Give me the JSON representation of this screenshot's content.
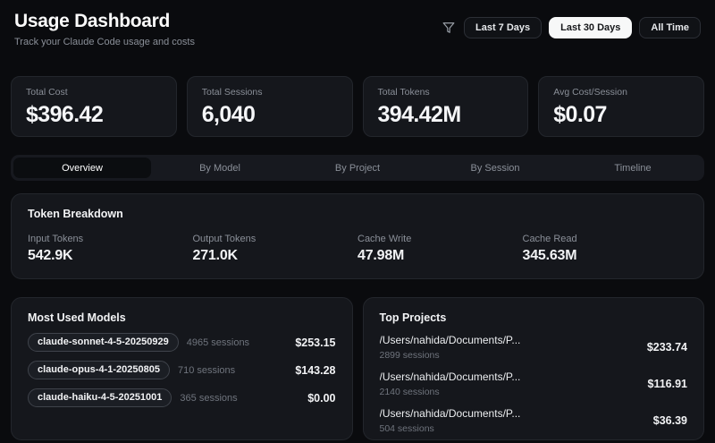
{
  "header": {
    "title": "Usage Dashboard",
    "subtitle": "Track your Claude Code usage and costs",
    "filter_icon": "funnel-icon",
    "ranges": [
      {
        "label": "Last 7 Days",
        "active": false
      },
      {
        "label": "Last 30 Days",
        "active": true
      },
      {
        "label": "All Time",
        "active": false
      }
    ]
  },
  "stats": [
    {
      "label": "Total Cost",
      "value": "$396.42"
    },
    {
      "label": "Total Sessions",
      "value": "6,040"
    },
    {
      "label": "Total Tokens",
      "value": "394.42M"
    },
    {
      "label": "Avg Cost/Session",
      "value": "$0.07"
    }
  ],
  "tabs": [
    {
      "label": "Overview",
      "active": true
    },
    {
      "label": "By Model",
      "active": false
    },
    {
      "label": "By Project",
      "active": false
    },
    {
      "label": "By Session",
      "active": false
    },
    {
      "label": "Timeline",
      "active": false
    }
  ],
  "token_breakdown": {
    "title": "Token Breakdown",
    "items": [
      {
        "label": "Input Tokens",
        "value": "542.9K"
      },
      {
        "label": "Output Tokens",
        "value": "271.0K"
      },
      {
        "label": "Cache Write",
        "value": "47.98M"
      },
      {
        "label": "Cache Read",
        "value": "345.63M"
      }
    ]
  },
  "most_used_models": {
    "title": "Most Used Models",
    "rows": [
      {
        "model": "claude-sonnet-4-5-20250929",
        "sessions": "4965 sessions",
        "cost": "$253.15"
      },
      {
        "model": "claude-opus-4-1-20250805",
        "sessions": "710 sessions",
        "cost": "$143.28"
      },
      {
        "model": "claude-haiku-4-5-20251001",
        "sessions": "365 sessions",
        "cost": "$0.00"
      }
    ]
  },
  "top_projects": {
    "title": "Top Projects",
    "rows": [
      {
        "path": "/Users/nahida/Documents/P...",
        "sessions": "2899 sessions",
        "cost": "$233.74"
      },
      {
        "path": "/Users/nahida/Documents/P...",
        "sessions": "2140 sessions",
        "cost": "$116.91"
      },
      {
        "path": "/Users/nahida/Documents/P...",
        "sessions": "504 sessions",
        "cost": "$36.39"
      }
    ]
  },
  "colors": {
    "background": "#0a0b0e",
    "card_background": "#15171c",
    "card_border": "#23262c",
    "muted_text": "#8a8f98",
    "active_filter_background": "#f7f8f8"
  }
}
